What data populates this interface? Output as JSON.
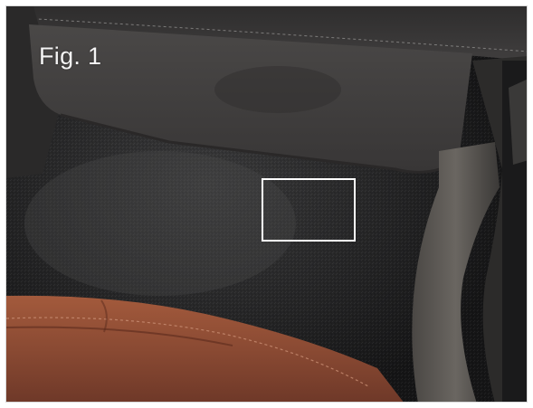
{
  "figure": {
    "label": "Fig. 1"
  },
  "scene": {
    "subject": "car-footwell-under-glovebox",
    "colors": {
      "glovebox": "#3d3b3b",
      "carpet": "#1f1f20",
      "door_sill_trim": "#57534f",
      "seat_leather": "#8a4a33",
      "highlight": "#ffffff"
    }
  }
}
